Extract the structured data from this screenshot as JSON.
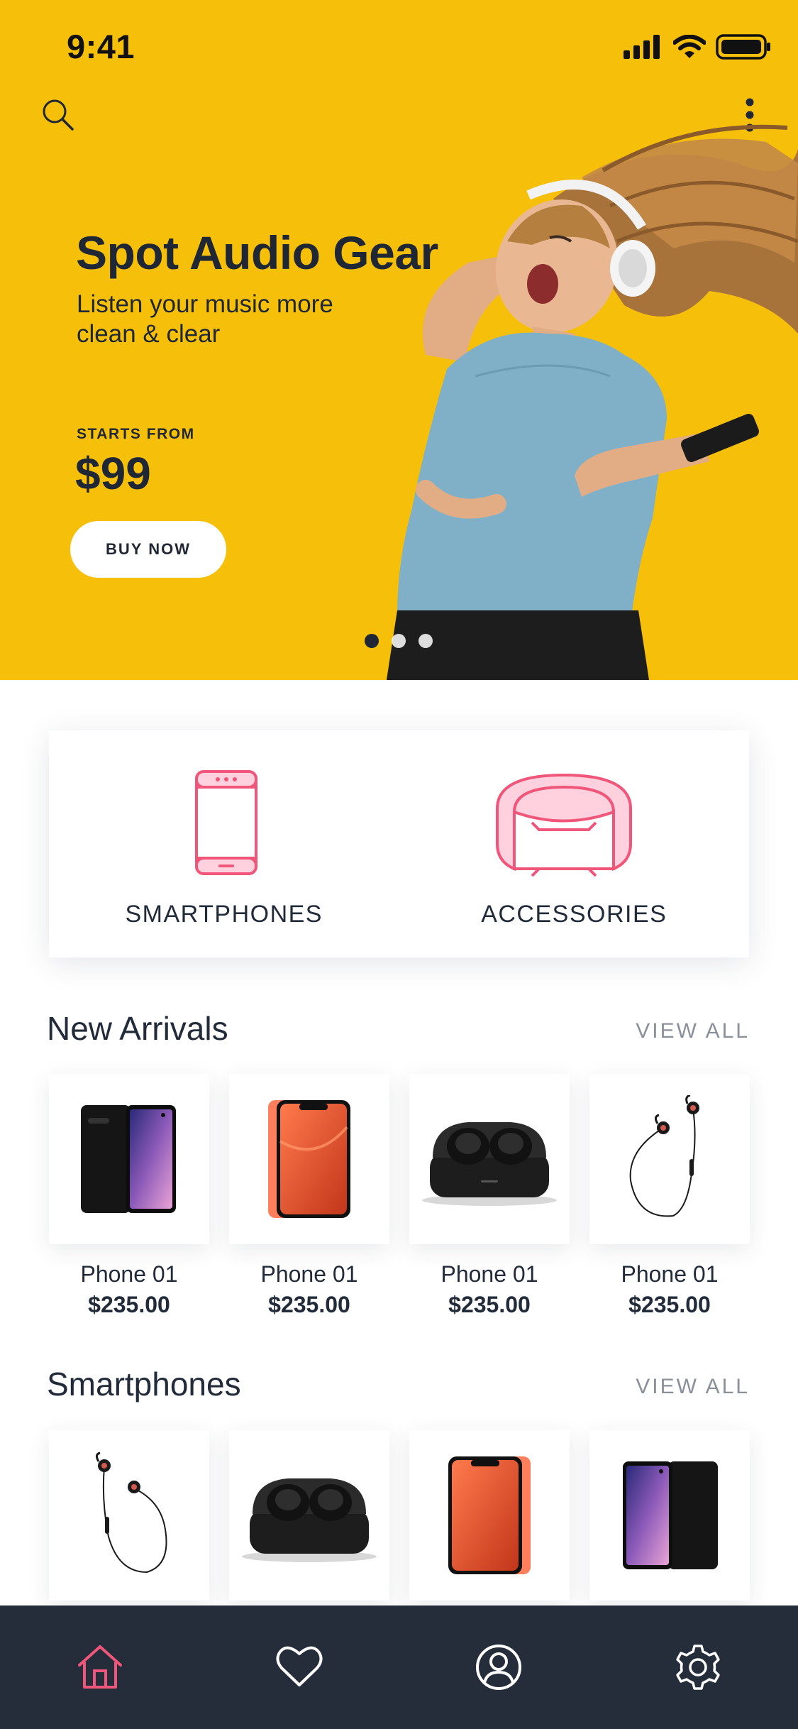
{
  "status_bar": {
    "time": "9:41"
  },
  "hero": {
    "title": "Spot Audio Gear",
    "subtitle": "Listen your music more clean & clear",
    "starts_from_label": "STARTS FROM",
    "price": "$99",
    "cta_label": "BUY NOW",
    "carousel": {
      "page_count": 3,
      "active_index": 0
    },
    "background_color": "#f6bf0a"
  },
  "categories": [
    {
      "label": "SMARTPHONES",
      "icon": "smartphone-icon"
    },
    {
      "label": "ACCESSORIES",
      "icon": "watch-band-icon"
    }
  ],
  "sections": [
    {
      "title": "New Arrivals",
      "view_all_label": "VIEW ALL",
      "products": [
        {
          "name": "Phone 01",
          "price": "$235.00",
          "image": "galaxy-phone"
        },
        {
          "name": "Phone 01",
          "price": "$235.00",
          "image": "coral-iphone"
        },
        {
          "name": "Phone 01",
          "price": "$235.00",
          "image": "earbuds-case"
        },
        {
          "name": "Phone 01",
          "price": "$235.00",
          "image": "wired-earphones"
        }
      ]
    },
    {
      "title": "Smartphones",
      "view_all_label": "VIEW ALL",
      "products": [
        {
          "image": "wired-earphones"
        },
        {
          "image": "earbuds-case"
        },
        {
          "image": "coral-iphone"
        },
        {
          "image": "galaxy-phone"
        }
      ]
    }
  ],
  "bottom_nav": [
    {
      "icon": "home-icon",
      "active": true
    },
    {
      "icon": "heart-icon",
      "active": false
    },
    {
      "icon": "user-icon",
      "active": false
    },
    {
      "icon": "gear-icon",
      "active": false
    }
  ],
  "colors": {
    "accent": "#f0567a",
    "dark": "#222b3a",
    "nav_bg": "#252d3b",
    "hero": "#f6bf0a"
  }
}
